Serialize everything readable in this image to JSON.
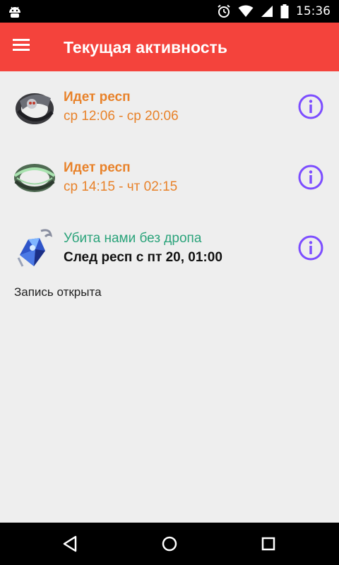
{
  "status_bar": {
    "time": "15:36",
    "icons": [
      "android-icon",
      "alarm-icon",
      "wifi-icon",
      "signal-icon",
      "battery-icon"
    ]
  },
  "app_bar": {
    "title": "Текущая активность",
    "background": "#f4433c"
  },
  "items": [
    {
      "status": "Идет респ",
      "detail": "ср 12:06 - ср 20:06",
      "status_color": "#e8822a",
      "icon": "dark-ring-icon"
    },
    {
      "status": "Идет респ",
      "detail": "ср 14:15 - чт 02:15",
      "status_color": "#e8822a",
      "icon": "green-ring-icon"
    },
    {
      "status": "Убита  нами без дропа",
      "detail": "След респ с пт 20, 01:00",
      "status_color": "#2aa37a",
      "icon": "blue-crystal-icon"
    }
  ],
  "footer": {
    "text": "Запись открыта"
  },
  "accent_info": "#7c4dff"
}
